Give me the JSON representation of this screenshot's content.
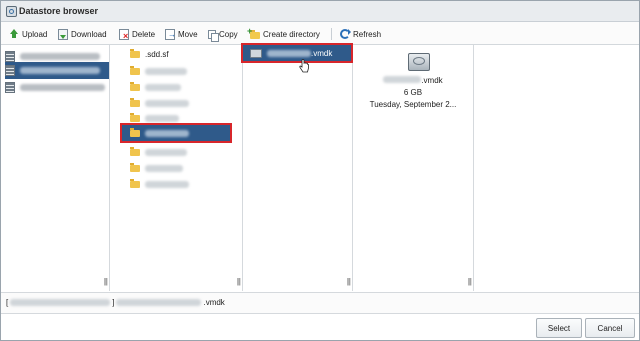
{
  "window": {
    "title": "Datastore browser"
  },
  "toolbar": {
    "upload": "Upload",
    "download": "Download",
    "delete": "Delete",
    "move": "Move",
    "copy": "Copy",
    "create_directory": "Create directory",
    "refresh": "Refresh"
  },
  "datastores": {
    "items": [
      {
        "label": ""
      },
      {
        "label": ""
      },
      {
        "label": ""
      }
    ]
  },
  "folders": {
    "first_label": ".sdd.sf"
  },
  "files": {
    "selected_suffix": ".vmdk"
  },
  "details": {
    "name_suffix": ".vmdk",
    "size": "6 GB",
    "modified": "Tuesday, September 2..."
  },
  "path": {
    "open_bracket": "[",
    "close_bracket": "]",
    "suffix": ".vmdk"
  },
  "footer": {
    "select": "Select",
    "cancel": "Cancel"
  },
  "grip_glyph": "|||",
  "colors": {
    "selection": "#2f5a8a",
    "highlight_box": "#d8262b"
  }
}
